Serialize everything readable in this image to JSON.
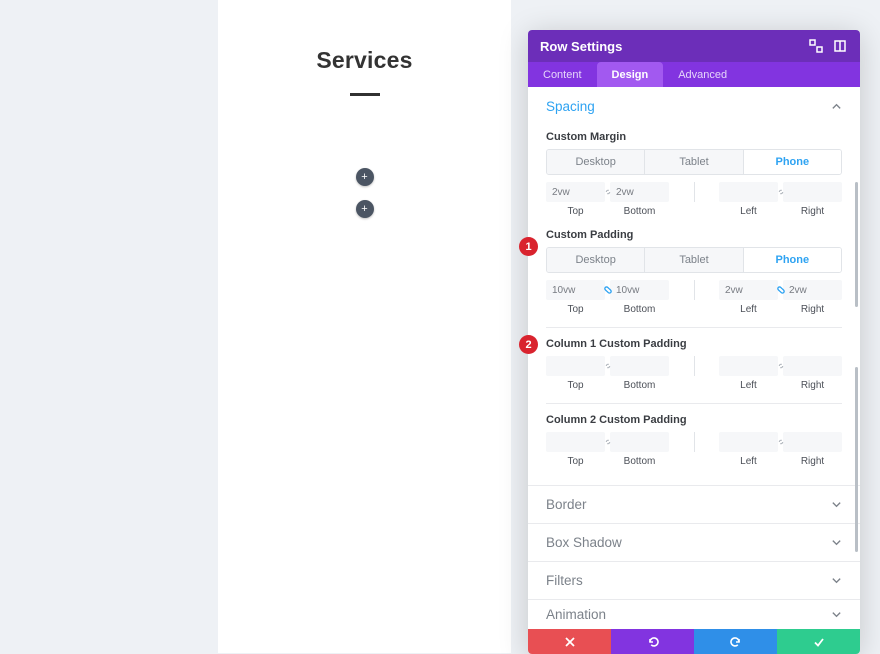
{
  "canvas": {
    "title": "Services",
    "plus_labels": [
      "+",
      "+"
    ]
  },
  "panel": {
    "title": "Row Settings",
    "tabs": {
      "content": "Content",
      "design": "Design",
      "advanced": "Advanced"
    },
    "sections": {
      "spacing": "Spacing",
      "border": "Border",
      "box_shadow": "Box Shadow",
      "filters": "Filters",
      "animation": "Animation"
    },
    "device": {
      "desktop": "Desktop",
      "tablet": "Tablet",
      "phone": "Phone"
    },
    "labels": {
      "top": "Top",
      "bottom": "Bottom",
      "left": "Left",
      "right": "Right"
    },
    "groups": {
      "custom_margin": "Custom Margin",
      "custom_padding": "Custom Padding",
      "col1_padding": "Column 1 Custom Padding",
      "col2_padding": "Column 2 Custom Padding"
    },
    "values": {
      "margin": {
        "top": "2vw",
        "bottom": "2vw",
        "left": "",
        "right": ""
      },
      "padding": {
        "top": "10vw",
        "bottom": "10vw",
        "left": "2vw",
        "right": "2vw"
      },
      "col1": {
        "top": "",
        "bottom": "",
        "left": "",
        "right": ""
      },
      "col2": {
        "top": "",
        "bottom": "",
        "left": "",
        "right": ""
      }
    },
    "badges": {
      "b1": "1",
      "b2": "2"
    }
  }
}
